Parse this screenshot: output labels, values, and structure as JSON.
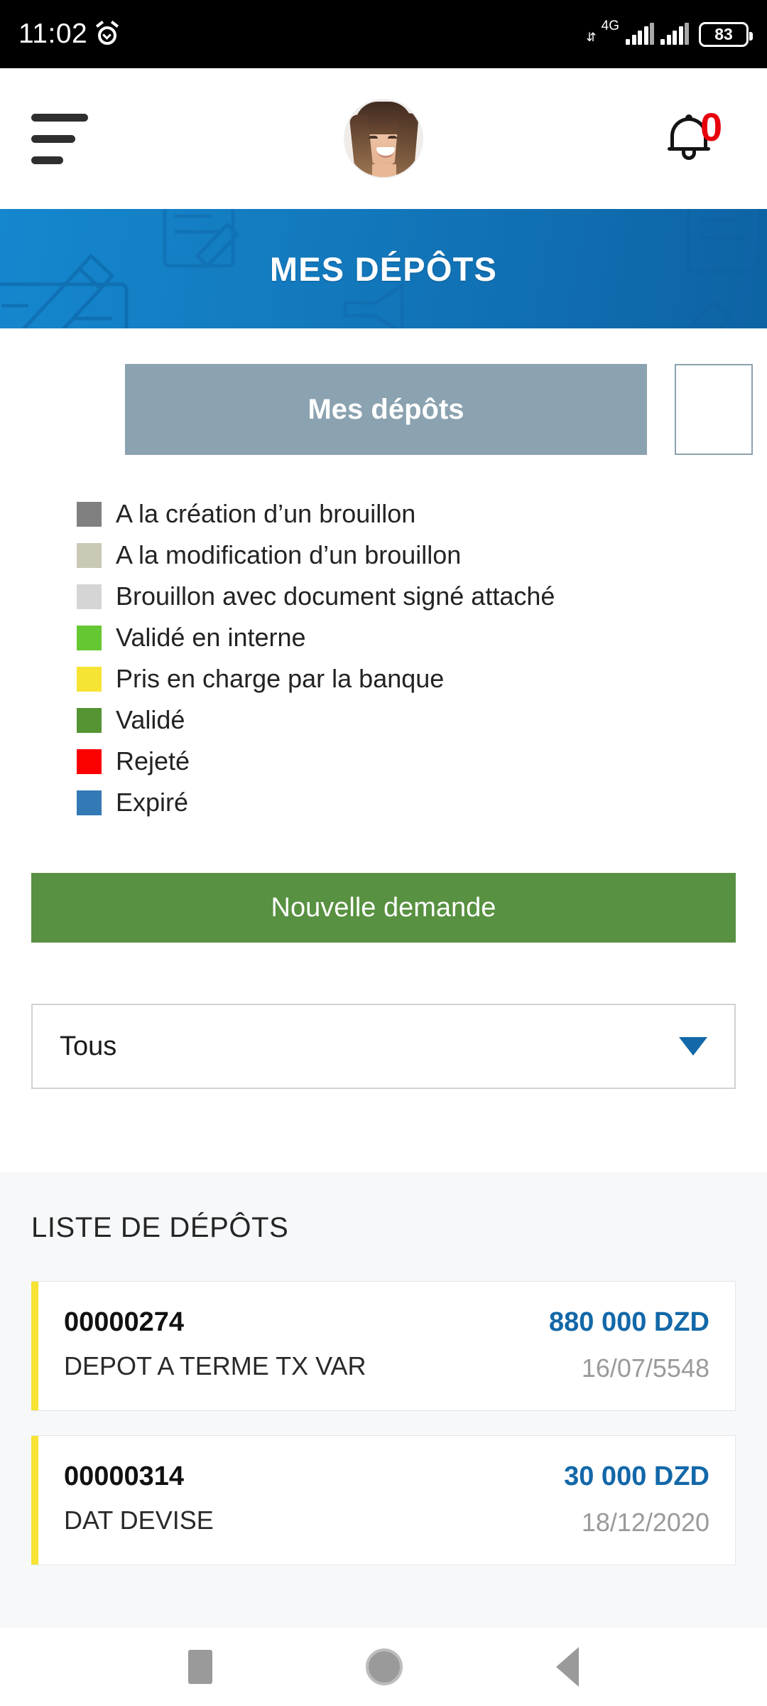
{
  "status_bar": {
    "time": "11:02",
    "alarm_icon": "alarm-clock-icon",
    "network_type": "4G",
    "battery_level": "83"
  },
  "app_bar": {
    "menu_icon": "hamburger-menu-icon",
    "avatar_label": "profile-avatar",
    "bell_icon": "notification-bell-icon",
    "notification_count": "0"
  },
  "banner": {
    "title": "MES DÉPÔTS"
  },
  "tabs": {
    "active": "Mes dépôts",
    "secondary": ""
  },
  "legend": {
    "items": [
      {
        "label": "A la création d’un brouillon",
        "color": "#808080"
      },
      {
        "label": "A la modification d’un brouillon",
        "color": "#c9c9b6"
      },
      {
        "label": "Brouillon avec document signé attaché",
        "color": "#d5d5d5"
      },
      {
        "label": "Validé en interne",
        "color": "#65c832"
      },
      {
        "label": "Pris en charge par la banque",
        "color": "#f6e334"
      },
      {
        "label": "Validé",
        "color": "#549433"
      },
      {
        "label": "Rejeté",
        "color": "#fb0000"
      },
      {
        "label": "Expiré",
        "color": "#3279b5"
      }
    ]
  },
  "actions": {
    "new_request_label": "Nouvelle demande",
    "new_request_color": "#589141"
  },
  "filter": {
    "selected": "Tous",
    "caret_icon": "chevron-down-icon"
  },
  "list": {
    "title": "LISTE DE DÉPÔTS",
    "currency": "DZD",
    "items": [
      {
        "reference": "00000274",
        "label": "DEPOT A TERME TX VAR",
        "amount": "880 000 DZD",
        "date": "16/07/5548",
        "status_color": "#f6e334"
      },
      {
        "reference": "00000314",
        "label": "DAT DEVISE",
        "amount": "30 000 DZD",
        "date": "18/12/2020",
        "status_color": "#f6e334"
      }
    ]
  },
  "nav_bar": {
    "recents_icon": "square-recents-icon",
    "home_icon": "circle-home-icon",
    "back_icon": "triangle-back-icon"
  }
}
